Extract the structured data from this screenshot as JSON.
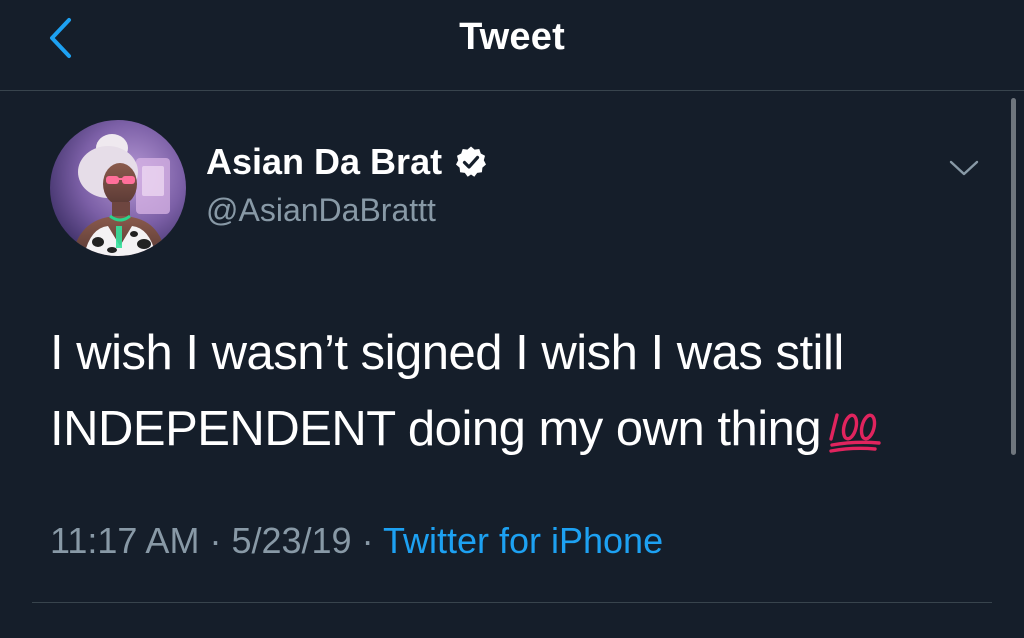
{
  "header": {
    "title": "Tweet",
    "back_icon": "chevron-left-icon"
  },
  "tweet": {
    "display_name": "Asian Da Brat",
    "handle": "@AsianDaBrattt",
    "verified_icon": "verified-badge-icon",
    "more_icon": "chevron-down-icon",
    "text_line1": "I wish I wasn’t signed I wish I was still",
    "text_line2": "INDEPENDENT doing my own thing",
    "emoji": "hundred-points-emoji",
    "time": "11:17 AM",
    "separator": "·",
    "date": "5/23/19",
    "source": "Twitter for iPhone"
  },
  "colors": {
    "background": "#151e2a",
    "accent": "#1da1f2",
    "secondary_text": "#8899a6",
    "divider": "#38444d",
    "emoji_red": "#e0245e"
  }
}
